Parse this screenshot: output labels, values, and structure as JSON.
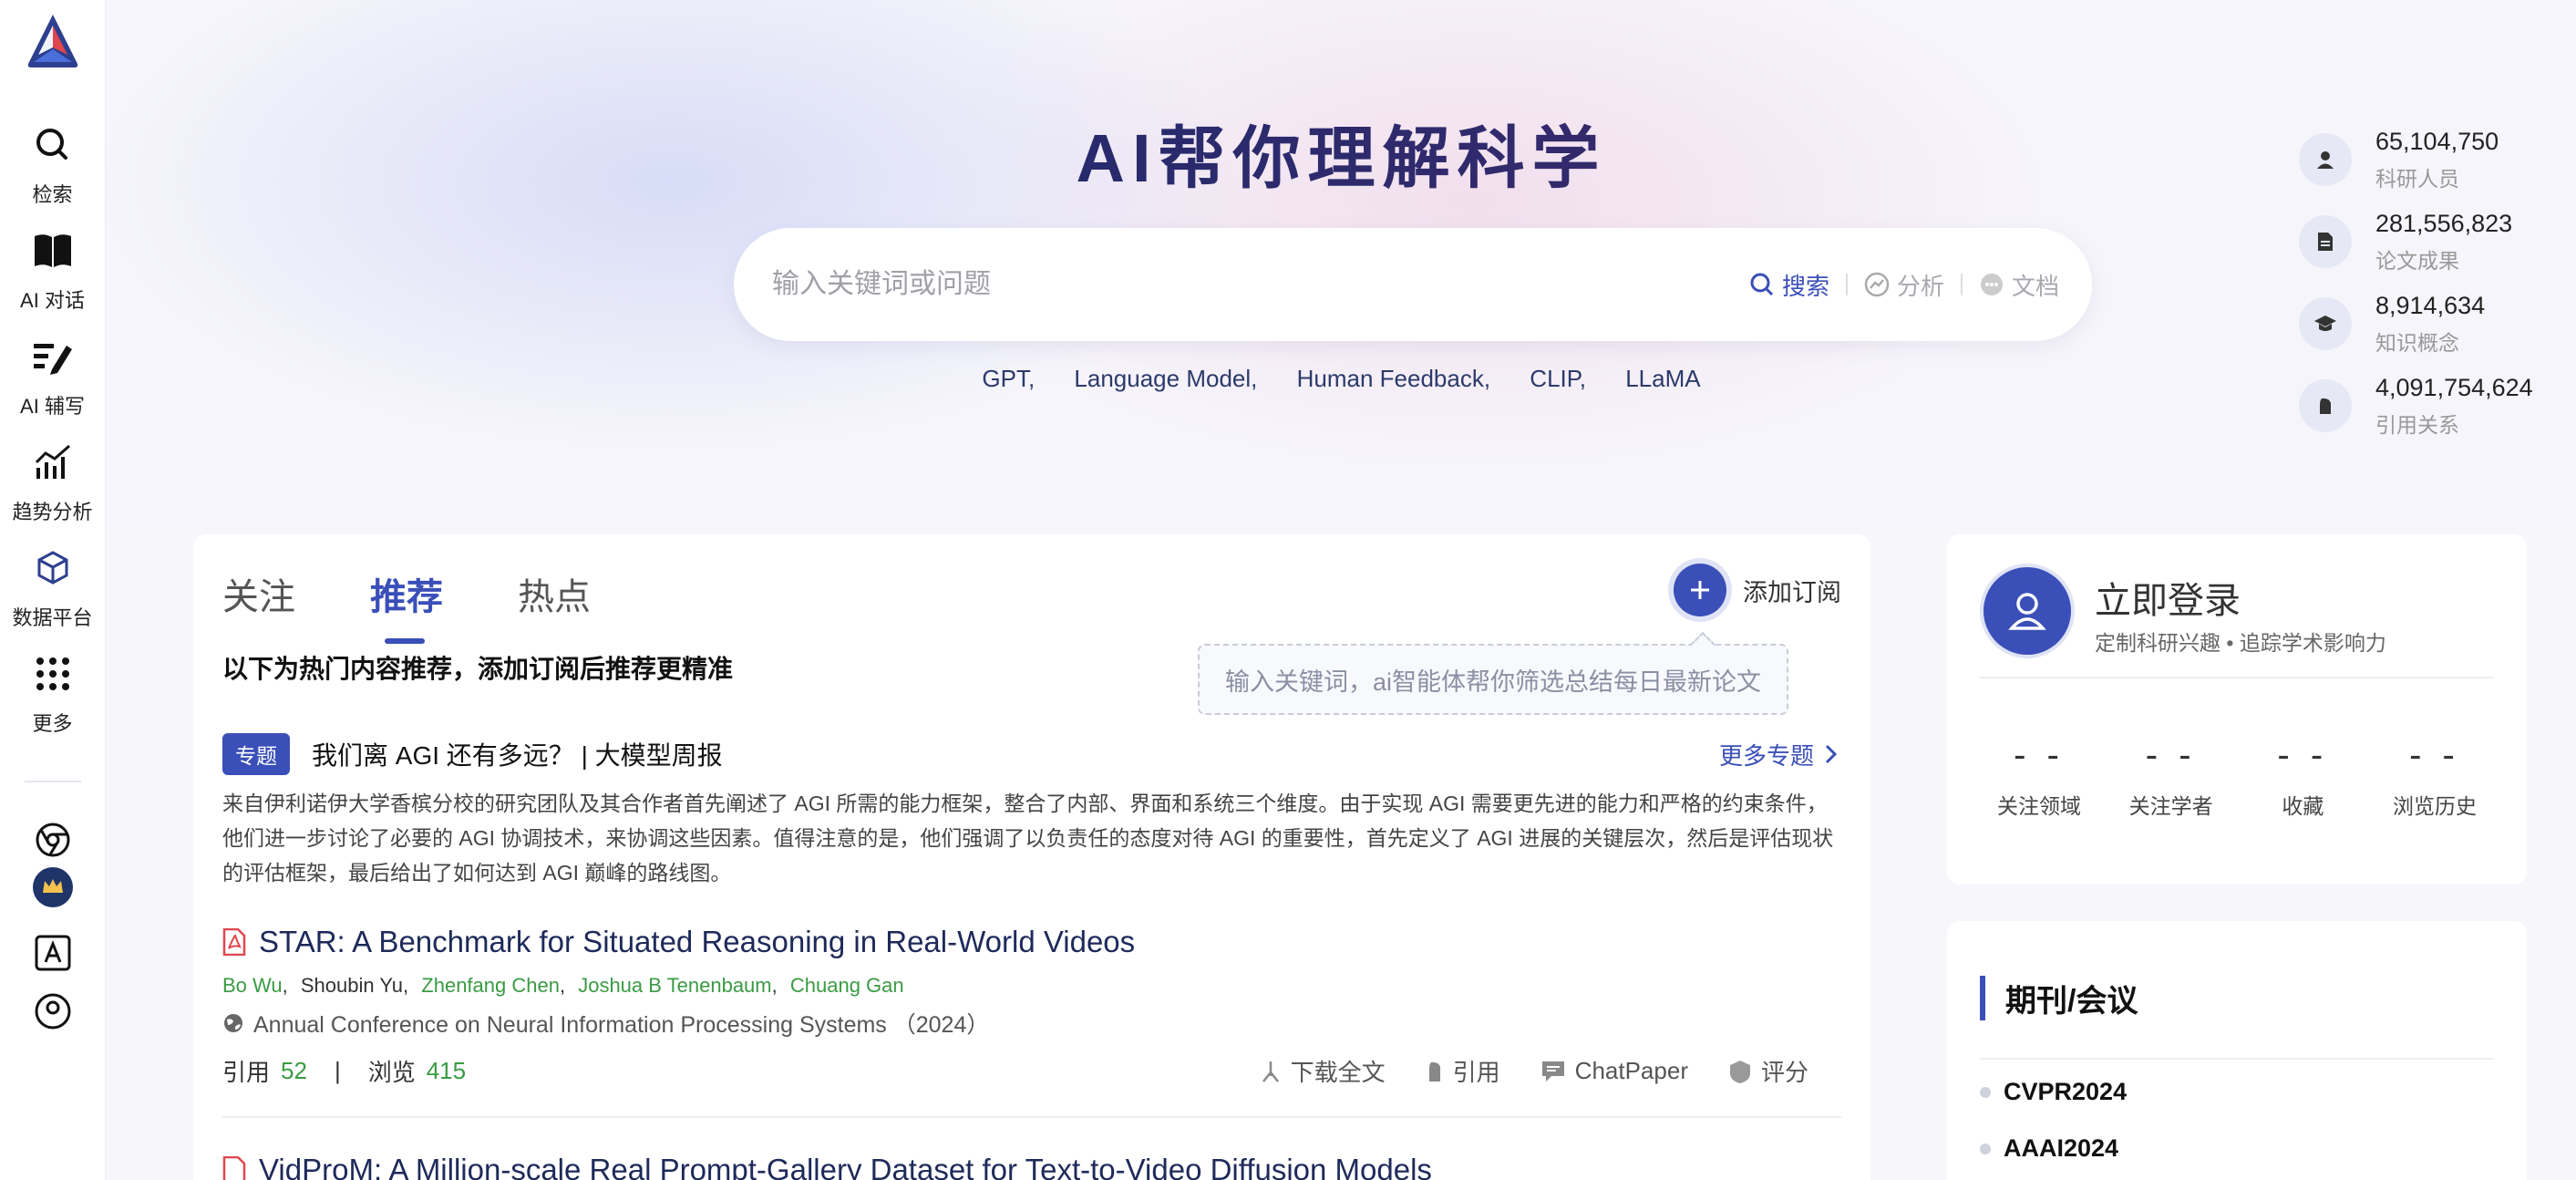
{
  "sidebar": {
    "items": [
      {
        "label": "检索",
        "icon": "search-icon"
      },
      {
        "label": "AI 对话",
        "icon": "book-icon"
      },
      {
        "label": "AI 辅写",
        "icon": "edit-icon"
      },
      {
        "label": "趋势分析",
        "icon": "trend-chart-icon"
      },
      {
        "label": "数据平台",
        "icon": "cube-icon"
      },
      {
        "label": "更多",
        "icon": "grid-dots-icon"
      }
    ]
  },
  "hero": {
    "title": "AI帮你理解科学",
    "search_placeholder": "输入关键词或问题",
    "actions": [
      {
        "label": "搜索",
        "icon": "search-icon",
        "active": true
      },
      {
        "label": "分析",
        "icon": "analysis-icon"
      },
      {
        "label": "文档",
        "icon": "document-chat-icon"
      }
    ],
    "hot_keywords": [
      "GPT,",
      "Language Model,",
      "Human Feedback,",
      "CLIP,",
      "LLaMA"
    ]
  },
  "stats": [
    {
      "value": "65,104,750",
      "label": "科研人员",
      "icon": "person-icon"
    },
    {
      "value": "281,556,823",
      "label": "论文成果",
      "icon": "paper-icon"
    },
    {
      "value": "8,914,634",
      "label": "知识概念",
      "icon": "graduation-cap-icon"
    },
    {
      "value": "4,091,754,624",
      "label": "引用关系",
      "icon": "quote-icon"
    }
  ],
  "feed": {
    "tabs": [
      "关注",
      "推荐",
      "热点"
    ],
    "active_tab": "推荐",
    "add_subscription": "添加订阅",
    "tooltip": "输入关键词，ai智能体帮你筛选总结每日最新论文",
    "intro": "以下为热门内容推荐，添加订阅后推荐更精准",
    "topic": {
      "badge": "专题",
      "title": "我们离 AGI 还有多远？ | 大模型周报",
      "more": "更多专题",
      "desc": "来自伊利诺伊大学香槟分校的研究团队及其合作者首先阐述了 AGI 所需的能力框架，整合了内部、界面和系统三个维度。由于实现 AGI 需要更先进的能力和严格的约束条件，他们进一步讨论了必要的 AGI 协调技术，来协调这些因素。值得注意的是，他们强调了以负责任的态度对待 AGI 的重要性，首先定义了 AGI 进展的关键层次，然后是评估现状的评估框架，最后给出了如何达到 AGI 巅峰的路线图。"
    },
    "paper1": {
      "title": "STAR: A Benchmark for Situated Reasoning in Real-World Videos",
      "authors": [
        {
          "name": "Bo Wu",
          "linked": true
        },
        {
          "name": "Shoubin Yu",
          "linked": false
        },
        {
          "name": "Zhenfang Chen",
          "linked": true
        },
        {
          "name": "Joshua B Tenenbaum",
          "linked": true
        },
        {
          "name": "Chuang Gan",
          "linked": true
        }
      ],
      "venue": "Annual Conference on Neural Information Processing Systems （2024）",
      "cite_label": "引用",
      "cite_count": "52",
      "view_label": "浏览",
      "view_count": "415",
      "actions": [
        "下载全文",
        "引用",
        "ChatPaper",
        "评分"
      ]
    },
    "paper2": {
      "title": "VidProM: A Million-scale Real Prompt-Gallery Dataset for Text-to-Video Diffusion Models"
    }
  },
  "login": {
    "title": "立即登录",
    "subtitle": "定制科研兴趣 • 追踪学术影响力",
    "stats": [
      {
        "value": "- -",
        "label": "关注领域"
      },
      {
        "value": "- -",
        "label": "关注学者"
      },
      {
        "value": "- -",
        "label": "收藏"
      },
      {
        "value": "- -",
        "label": "浏览历史"
      }
    ]
  },
  "journals": {
    "title": "期刊/会议",
    "items": [
      "CVPR2024",
      "AAAI2024"
    ]
  },
  "colors": {
    "accent": "#3a4fb8",
    "green": "#3a9b43"
  }
}
